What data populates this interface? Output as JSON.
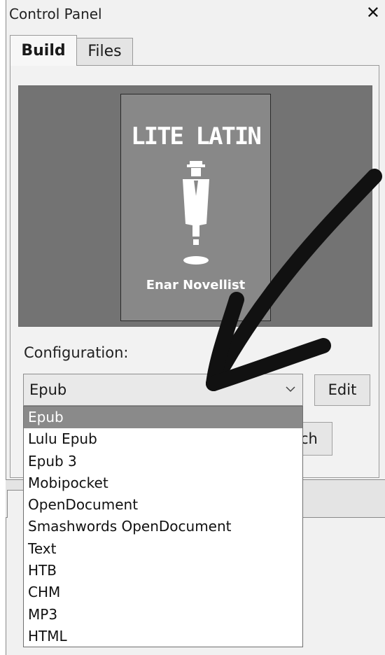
{
  "window": {
    "title": "Control Panel",
    "close_glyph": "✕"
  },
  "tabs": [
    {
      "label": "Build",
      "active": true
    },
    {
      "label": "Files",
      "active": false
    }
  ],
  "cover": {
    "title": "LITE LATIN",
    "author": "Enar Novellist"
  },
  "configuration": {
    "label": "Configuration:",
    "selected": "Epub",
    "edit_label": "Edit",
    "hidden_button_partial": "ch"
  },
  "dropdown": {
    "options": [
      "Epub",
      "Lulu Epub",
      "Epub 3",
      "Mobipocket",
      "OpenDocument",
      "Smashwords OpenDocument",
      "Text",
      "HTB",
      "CHM",
      "MP3",
      "HTML"
    ],
    "selected_index": 0
  },
  "colors": {
    "selected_option_bg": "#8a8a8a",
    "preview_bg": "#737373",
    "arrow": "#111111"
  },
  "icons": [
    "close-icon",
    "chevron-down-icon",
    "figure-icon"
  ]
}
